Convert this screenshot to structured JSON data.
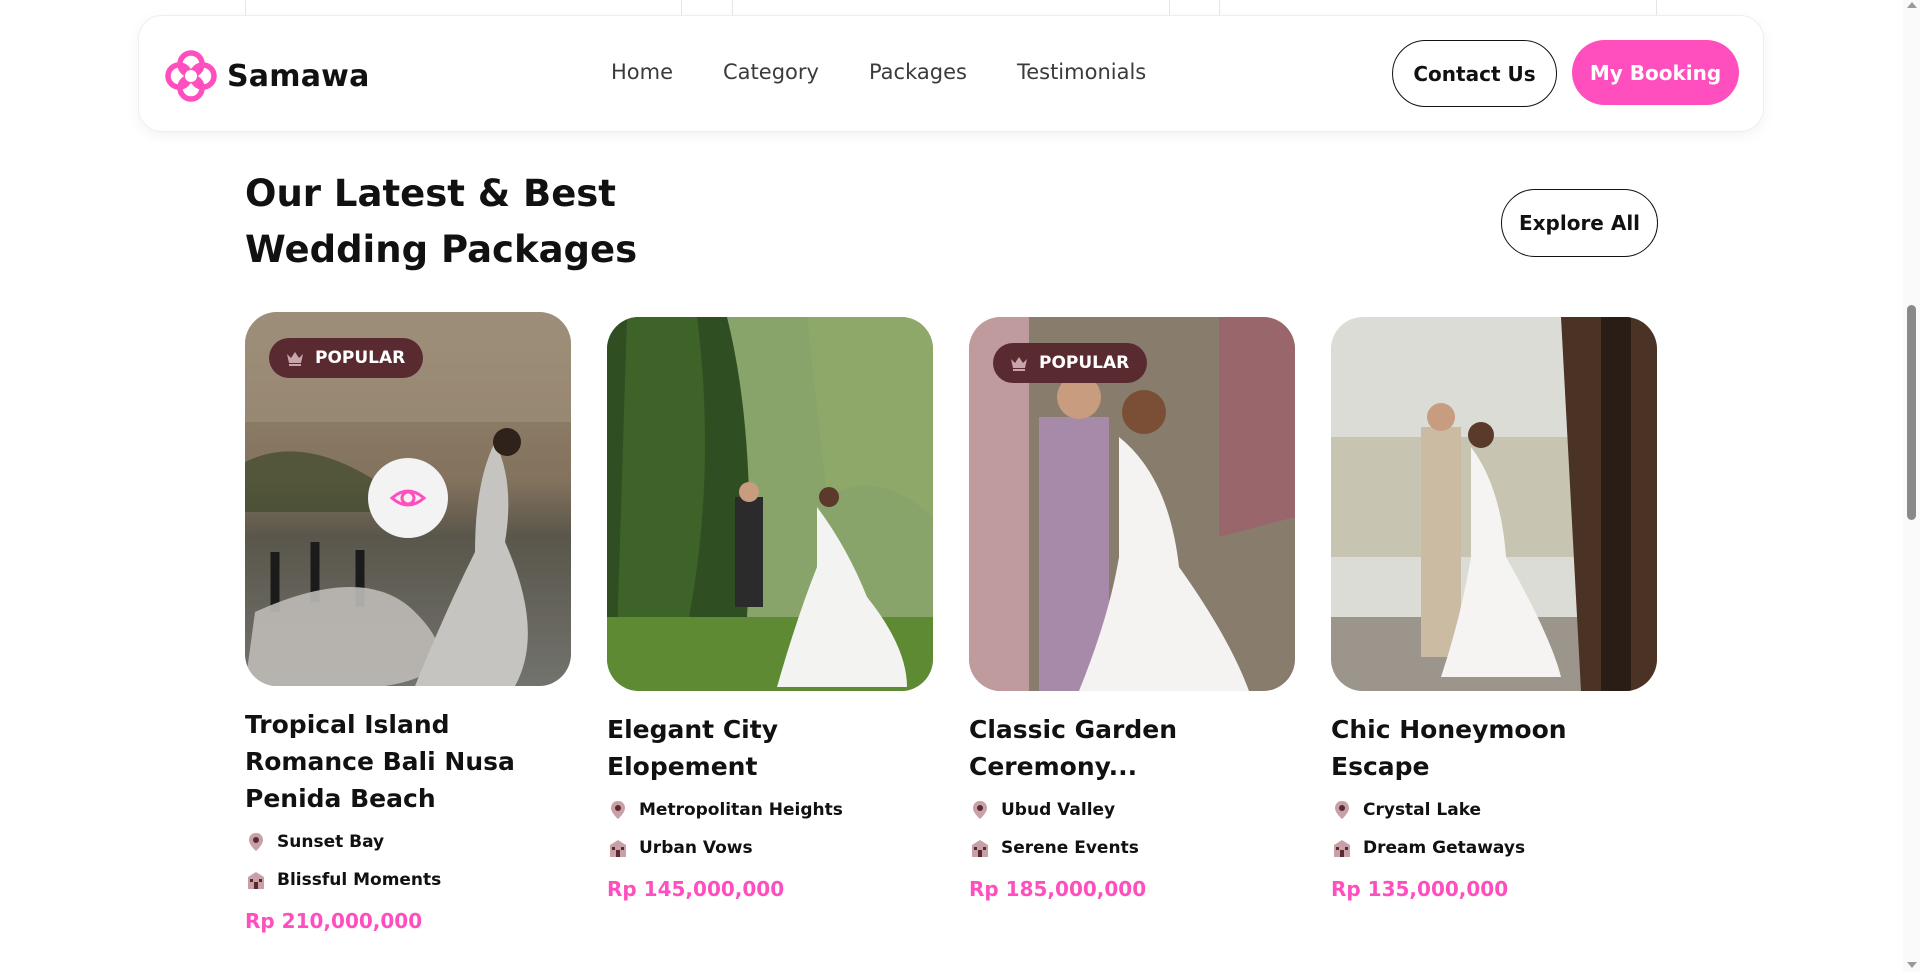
{
  "brand": {
    "name": "Samawa",
    "color": "#ff4fbf"
  },
  "nav": {
    "links": [
      "Home",
      "Category",
      "Packages",
      "Testimonials"
    ],
    "contact_label": "Contact Us",
    "booking_label": "My Booking"
  },
  "section": {
    "title": "Our Latest & Best Wedding Packages",
    "explore_label": "Explore All"
  },
  "packages": [
    {
      "title": "Tropical Island Romance Bali Nusa Penida Beach",
      "badge": "POPULAR",
      "location": "Sunset Bay",
      "organizer": "Blissful Moments",
      "price": "Rp 210,000,000",
      "icons": {
        "badge": "crown-icon",
        "location": "map-pin-icon",
        "organizer": "building-icon",
        "view": "eye-icon"
      }
    },
    {
      "title": "Elegant City Elopement",
      "badge": "",
      "location": "Metropolitan Heights",
      "organizer": "Urban Vows",
      "price": "Rp 145,000,000"
    },
    {
      "title": "Classic Garden Ceremony...",
      "badge": "POPULAR",
      "location": "Ubud Valley",
      "organizer": "Serene Events",
      "price": "Rp 185,000,000"
    },
    {
      "title": "Chic Honeymoon Escape",
      "badge": "",
      "location": "Crystal Lake",
      "organizer": "Dream Getaways",
      "price": "Rp 135,000,000"
    }
  ],
  "colors": {
    "badge_bg": "#5a2a31",
    "price": "#ff4fbf",
    "accent": "#ff4fbf"
  }
}
